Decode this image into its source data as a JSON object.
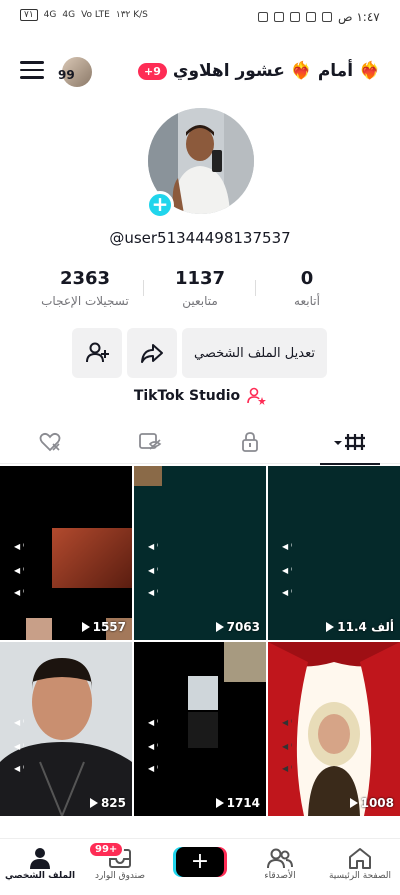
{
  "status_bar": {
    "time": "١:٤٧ ص",
    "battery": "٧١",
    "network_1": "4G",
    "network_2": "4G",
    "volte": "Vo LTE",
    "speed": "١٣٢ K/S"
  },
  "header": {
    "notification_count": "99",
    "badge": "+9",
    "title": "أمام ❤️‍🔥 عشور اهلاوي ❤️‍🔥"
  },
  "profile": {
    "username": "@user51344498137537",
    "stats": [
      {
        "value": "0",
        "label": "أتابعه"
      },
      {
        "value": "1137",
        "label": "متابعين"
      },
      {
        "value": "2363",
        "label": "تسجيلات الإعجاب"
      }
    ],
    "edit_profile_label": "تعديل الملف الشخصي",
    "studio_label": "TikTok Studio"
  },
  "tabs": [
    "videos-tab",
    "private-tab",
    "reposts-tab",
    "liked-tab"
  ],
  "videos": [
    {
      "views": "11.4 ألف"
    },
    {
      "views": "7063"
    },
    {
      "views": "1557"
    },
    {
      "views": "1008"
    },
    {
      "views": "1714"
    },
    {
      "views": "825"
    }
  ],
  "bottom_nav": {
    "home": "الصفحة الرئيسية",
    "friends": "الأصدقاء",
    "inbox": "صندوق الوارد",
    "inbox_badge": "99+",
    "profile": "الملف الشخصي"
  },
  "colors": {
    "accent_red": "#fe2c55",
    "accent_cyan": "#20d5ec"
  }
}
